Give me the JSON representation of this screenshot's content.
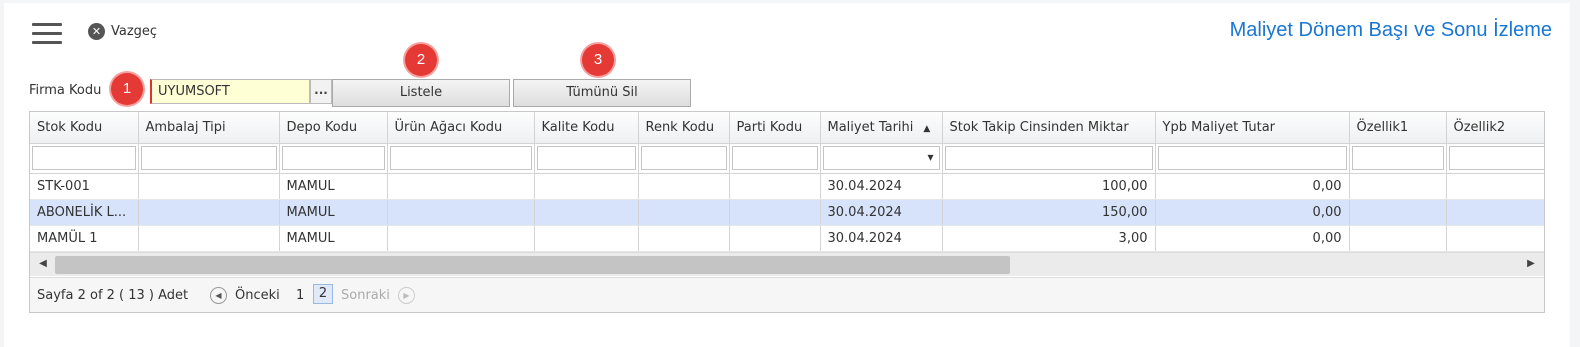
{
  "header": {
    "cancel_label": "Vazgeç",
    "title": "Maliyet Dönem Başı ve Sonu İzleme"
  },
  "form": {
    "firm_label": "Firma Kodu",
    "firm_value": "UYUMSOFT",
    "dots": "...",
    "list_button": "Listele",
    "delete_all_button": "Tümünü Sil",
    "badges": [
      "1",
      "2",
      "3"
    ]
  },
  "grid": {
    "columns": [
      "Stok Kodu",
      "Ambalaj Tipi",
      "Depo Kodu",
      "Ürün Ağacı Kodu",
      "Kalite Kodu",
      "Renk Kodu",
      "Parti Kodu",
      "Maliyet Tarihi",
      "Stok Takip Cinsinden Miktar",
      "Ypb Maliyet Tutar",
      "Özellik1",
      "Özellik2"
    ],
    "sort_indicator": "▲",
    "rows": [
      [
        "STK-001",
        "",
        "MAMUL",
        "",
        "",
        "",
        "",
        "30.04.2024",
        "100,00",
        "0,00",
        "",
        ""
      ],
      [
        "ABONELİK L...",
        "",
        "MAMUL",
        "",
        "",
        "",
        "",
        "30.04.2024",
        "150,00",
        "0,00",
        "",
        ""
      ],
      [
        "MAMÜL 1",
        "",
        "MAMUL",
        "",
        "",
        "",
        "",
        "30.04.2024",
        "3,00",
        "0,00",
        "",
        ""
      ]
    ]
  },
  "pager": {
    "info": "Sayfa 2 of 2 ( 13 ) Adet",
    "prev": "Önceki",
    "page1": "1",
    "page2": "2",
    "next": "Sonraki"
  }
}
